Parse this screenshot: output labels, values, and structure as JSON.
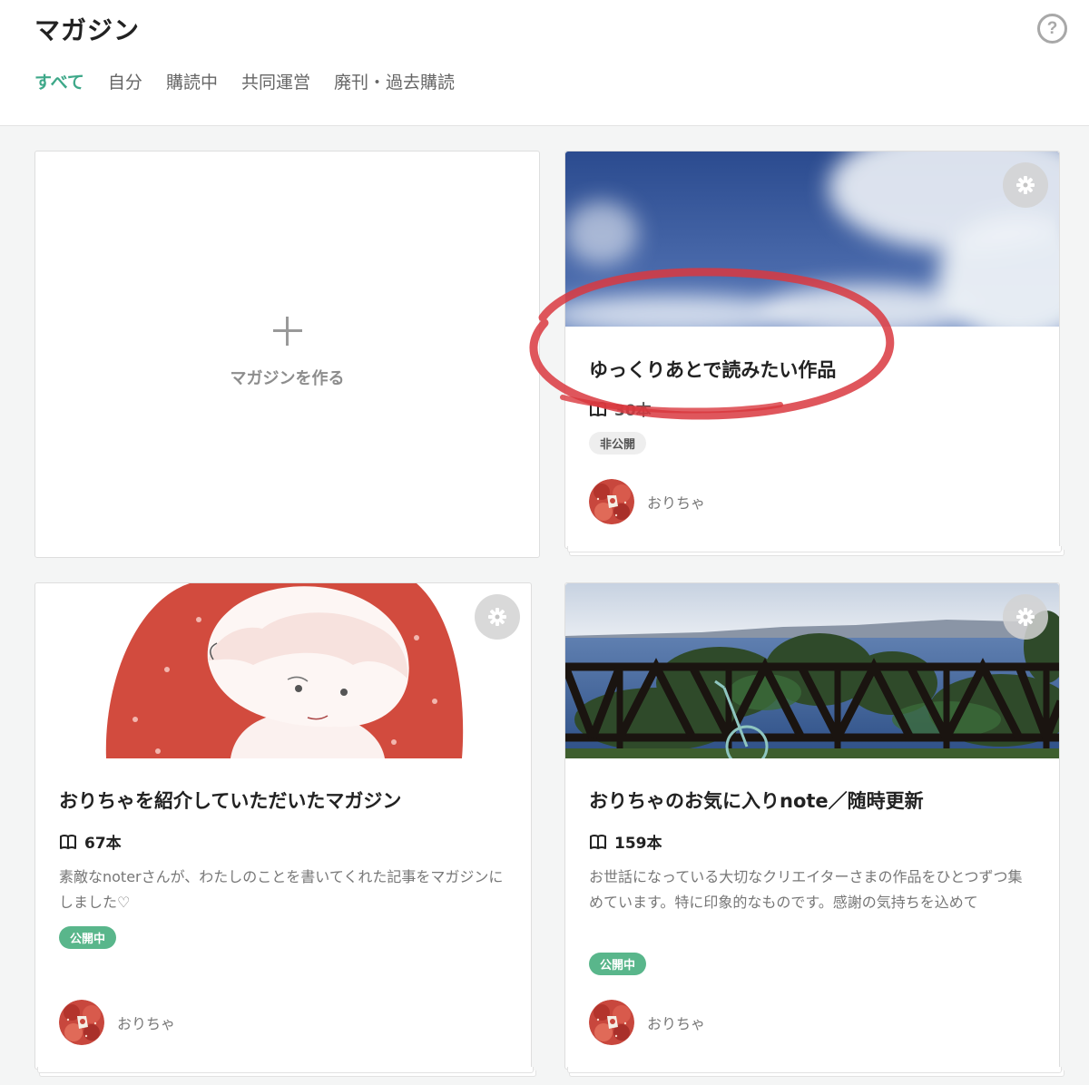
{
  "header": {
    "title": "マガジン",
    "help_symbol": "?",
    "tabs": [
      {
        "label": "すべて",
        "active": true
      },
      {
        "label": "自分",
        "active": false
      },
      {
        "label": "購読中",
        "active": false
      },
      {
        "label": "共同運営",
        "active": false
      },
      {
        "label": "廃刊・過去購読",
        "active": false
      }
    ]
  },
  "create_card": {
    "label": "マガジンを作る"
  },
  "magazines": [
    {
      "title": "ゆっくりあとで読みたい作品",
      "count": "30本",
      "status": "非公開",
      "author": "おりちゃ"
    },
    {
      "title": "おりちゃを紹介していただいたマガジン",
      "count": "67本",
      "description": "素敵なnoterさんが、わたしのことを書いてくれた記事をマガジンにしました♡",
      "status": "公開中",
      "author": "おりちゃ"
    },
    {
      "title": "おりちゃのお気に入りnote／随時更新",
      "count": "159本",
      "description": "お世話になっている大切なクリエイターさまの作品をひとつずつ集めています。特に印象的なものです。感謝の気持ちを込めて",
      "status": "公開中",
      "author": "おりちゃ"
    }
  ],
  "colors": {
    "accent": "#3ea889",
    "public_badge": "#59b68b",
    "annotation": "#d9383f"
  },
  "icons": [
    "help-icon",
    "plus-icon",
    "gear-icon",
    "book-icon",
    "avatar-strawberry"
  ]
}
